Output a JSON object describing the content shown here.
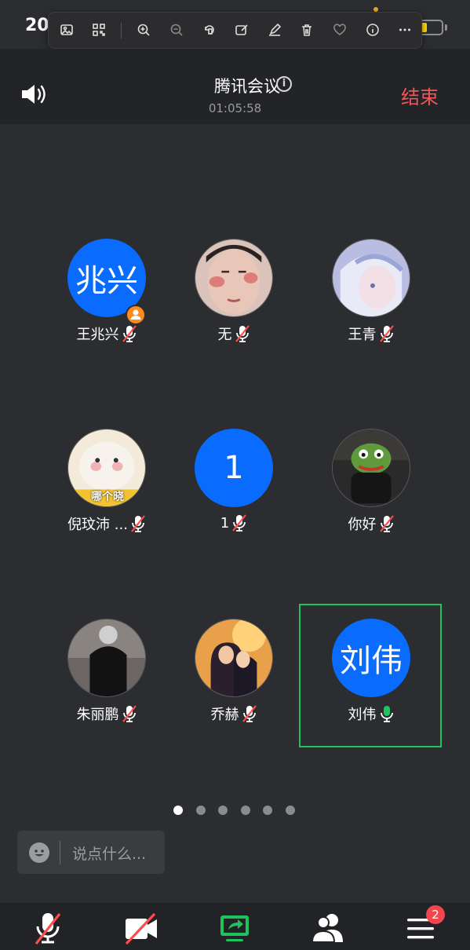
{
  "status_bar": {
    "time": "20"
  },
  "meeting": {
    "title": "腾讯会议",
    "elapsed": "01:05:58",
    "end_label": "结束"
  },
  "participants": [
    {
      "name": "王兆兴",
      "avatar_text": "兆兴",
      "avatar_type": "initials",
      "mic": "muted",
      "host": true
    },
    {
      "name": "无",
      "avatar_type": "photo",
      "mic": "muted"
    },
    {
      "name": "王青",
      "avatar_type": "photo",
      "mic": "muted"
    },
    {
      "name": "倪玟沛 ...",
      "avatar_type": "photo",
      "avatar_caption": "哪个晓",
      "mic": "muted"
    },
    {
      "name": "1",
      "avatar_text": "1",
      "avatar_type": "initials",
      "mic": "muted"
    },
    {
      "name": "你好",
      "avatar_type": "photo",
      "mic": "muted"
    },
    {
      "name": "朱丽鹏",
      "avatar_type": "photo",
      "mic": "muted"
    },
    {
      "name": "乔赫",
      "avatar_type": "photo",
      "mic": "muted"
    },
    {
      "name": "刘伟",
      "avatar_text": "刘伟",
      "avatar_type": "initials",
      "mic": "speaking",
      "active_speaker": true
    }
  ],
  "pagination": {
    "pages": 6,
    "current": 1
  },
  "chat": {
    "placeholder": "说点什么..."
  },
  "toolbar": {
    "participants_badge": "2"
  },
  "colors": {
    "accent_blue": "#0a6cff",
    "end_red": "#f2555a",
    "speaking_green": "#1fc35e",
    "muted_red": "#ff4d4f"
  }
}
